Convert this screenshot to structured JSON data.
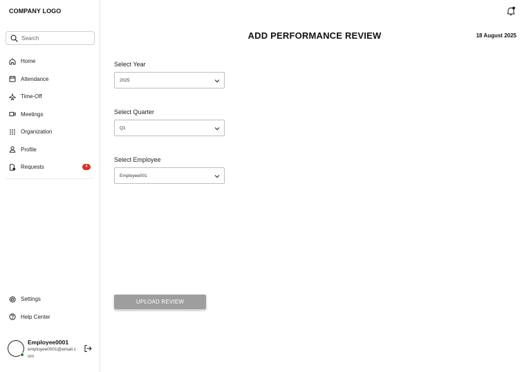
{
  "sidebar": {
    "logo": "COMPANY LOGO",
    "search": {
      "placeholder": "Search"
    },
    "items": [
      {
        "label": "Home",
        "icon": "home-icon"
      },
      {
        "label": "Attendance",
        "icon": "calendar-icon"
      },
      {
        "label": "Time-Off",
        "icon": "plane-icon"
      },
      {
        "label": "Meetings",
        "icon": "video-icon"
      },
      {
        "label": "Organization",
        "icon": "grid-icon"
      },
      {
        "label": "Profile",
        "icon": "user-icon"
      },
      {
        "label": "Requests",
        "icon": "document-icon",
        "badge": "4"
      }
    ],
    "bottom_items": [
      {
        "label": "Settings",
        "icon": "gear-icon"
      },
      {
        "label": "Help Center",
        "icon": "help-icon"
      }
    ],
    "user": {
      "name": "Employee0001",
      "email": "employee0001@email.com",
      "status_color": "#2e7d32"
    }
  },
  "header": {
    "title": "ADD PERFORMANCE REVIEW",
    "date": "18 August 2025"
  },
  "form": {
    "year": {
      "label": "Select Year",
      "value": "2025"
    },
    "quarter": {
      "label": "Select Quarter",
      "value": "Q1"
    },
    "employee": {
      "label": "Select Employee",
      "value": "Employee001"
    },
    "submit_label": "UPLOAD REVIEW"
  },
  "colors": {
    "badge": "#d93025",
    "button_disabled": "#9e9e9e"
  }
}
